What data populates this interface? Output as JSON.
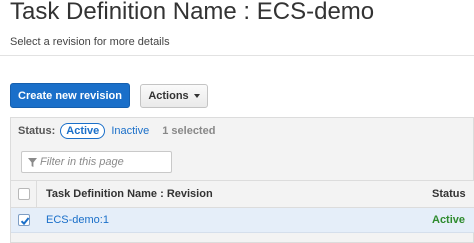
{
  "header": {
    "title": "Task Definition Name : ECS-demo",
    "subtitle": "Select a revision for more details"
  },
  "toolbar": {
    "create_label": "Create new revision",
    "actions_label": "Actions"
  },
  "status_filter": {
    "label": "Status:",
    "active_label": "Active",
    "inactive_label": "Inactive",
    "selected_count": "1 selected"
  },
  "search": {
    "placeholder": "Filter in this page",
    "value": ""
  },
  "table": {
    "columns": [
      "Task Definition Name : Revision",
      "Status"
    ],
    "rows": [
      {
        "name": "ECS-demo:1",
        "status": "Active",
        "selected": true
      }
    ]
  },
  "colors": {
    "primary": "#1a6fc9",
    "active_status": "#2e8b2e",
    "selected_row": "#e5eef9"
  }
}
